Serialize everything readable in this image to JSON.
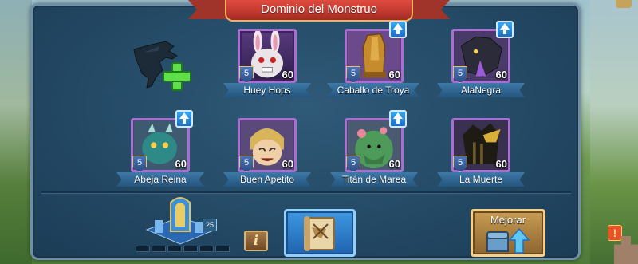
{
  "title": "Dominio del Monstruo",
  "monsters": [
    {
      "name": "Huey Hops",
      "level": "5",
      "power": "60",
      "upgrade_available": false,
      "accent": "#e7e7e7"
    },
    {
      "name": "Caballo de Troya",
      "level": "5",
      "power": "60",
      "upgrade_available": true,
      "accent": "#c58b2c"
    },
    {
      "name": "AlaNegra",
      "level": "5",
      "power": "60",
      "upgrade_available": true,
      "accent": "#2b2b3a"
    },
    {
      "name": "Abeja Reina",
      "level": "5",
      "power": "60",
      "upgrade_available": true,
      "accent": "#2e8a86"
    },
    {
      "name": "Buen Apetito",
      "level": "5",
      "power": "60",
      "upgrade_available": false,
      "accent": "#d8b45a"
    },
    {
      "name": "Titán de Marea",
      "level": "5",
      "power": "60",
      "upgrade_available": true,
      "accent": "#4e9a5a"
    },
    {
      "name": "La Muerte",
      "level": "5",
      "power": "60",
      "upgrade_available": false,
      "accent": "#6a5a2a"
    }
  ],
  "hoard": {
    "level": "25"
  },
  "buttons": {
    "info": "i",
    "upgrade": "Mejorar"
  },
  "alert_badge": "!",
  "colors": {
    "panel": "#244a66",
    "card_border": "#a86fd0",
    "ribbon": "#c33a30",
    "upgrade_arrow": "#3aa7f0"
  }
}
